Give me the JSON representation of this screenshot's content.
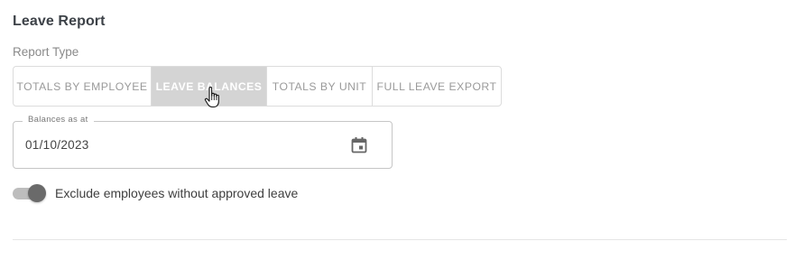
{
  "page": {
    "title": "Leave Report"
  },
  "report_type": {
    "label": "Report Type",
    "options": [
      {
        "label": "TOTALS BY EMPLOYEE",
        "selected": false
      },
      {
        "label": "LEAVE BALANCES",
        "selected": true
      },
      {
        "label": "TOTALS BY UNIT",
        "selected": false
      },
      {
        "label": "FULL LEAVE EXPORT",
        "selected": false
      }
    ]
  },
  "balances_date": {
    "label": "Balances as at",
    "value": "01/10/2023",
    "icon": "calendar-icon"
  },
  "exclude_toggle": {
    "label": "Exclude employees without approved leave",
    "checked": true
  },
  "cursor": {
    "icon": "hand-pointer-icon"
  },
  "colors": {
    "selected_bg": "#d4d4d4",
    "unselected_text": "#9a9a9a",
    "switch_thumb": "#6a6a6a",
    "switch_track": "#bdbdbd"
  }
}
